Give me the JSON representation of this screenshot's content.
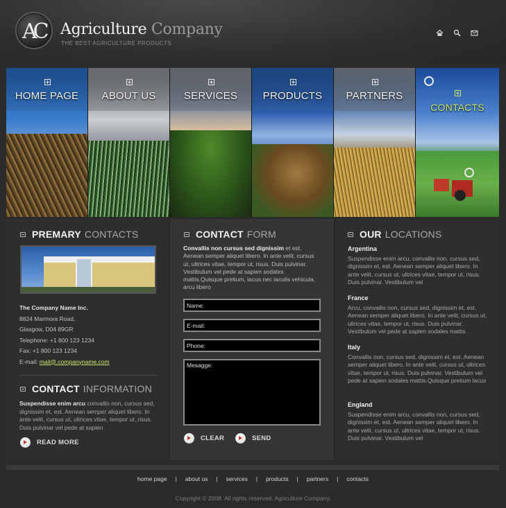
{
  "header": {
    "logo_letters": "AC",
    "brand_bold": "Agriculture",
    "brand_light": "Company",
    "tagline": "THE BEST AGRICULTURE PRODUCTS",
    "icons": [
      "home-icon",
      "search-icon",
      "mail-icon"
    ]
  },
  "nav": {
    "items": [
      {
        "label": "HOME PAGE"
      },
      {
        "label": "ABOUT US"
      },
      {
        "label": "SERVICES"
      },
      {
        "label": "PRODUCTS"
      },
      {
        "label": "PARTNERS"
      },
      {
        "label": "CONTACTS"
      }
    ],
    "active_color": "#c9e86a"
  },
  "primary_contacts": {
    "title_bold": "PREMARY",
    "title_light": "CONTACTS",
    "company": "The Company Name Inc.",
    "street": "8824 Marmora Road,",
    "city": "Glasgow, D04 89GR",
    "telephone": "Telephone: +1 800 123 1234",
    "fax": "Fax: +1 800 123 1234",
    "email_label": "E-mail:",
    "email": "mail@.companyname.com"
  },
  "contact_info": {
    "title_bold": "CONTACT",
    "title_light": "INFORMATION",
    "lead": "Suspendisse enim arcu",
    "text": " convallis non, cursus sed, dignissim et, est. Aenean semper aliquet libero. In ante velit, cursus ut, ultrices vitae, tempor ut, risus. Duis pulvinar vel pede at sapien",
    "read_more": "READ MORE"
  },
  "contact_form": {
    "title_bold": "CONTACT",
    "title_light": "FORM",
    "intro_bold": "Convallis non cursus sed dignissim",
    "intro_text": " et est. Aenean semper aliquet libero. In ante velit, cursus ut, ultrices vitae, tempor ut, risus. Duis pulvinar. Vestibulum vel pede at sapien sodales mattis.Quisque pretium, lacus nec iaculis vehicula, arcu libero",
    "name_value": "Name:",
    "email_value": "E-mail:",
    "phone_value": "Phone:",
    "message_value": "Mesagge:",
    "clear_label": "CLEAR",
    "send_label": "SEND"
  },
  "locations": {
    "title_bold": "OUR",
    "title_light": "LOCATIONS",
    "items": [
      {
        "name": "Argentina",
        "text": "Suspendisse enim arcu, convallis non, cursus sed, dignissim et, est. Aenean semper aliquet libero. In ante velit, cursus ut, ultrices vitae, tempor ut, risus. Duis pulvinar. Vestibulum vel"
      },
      {
        "name": "France",
        "text": "Arcu, convallis non, cursus sed, dignissim et, est. Aenean semper aliquet libero. In ante velit, cursus ut, ultrices vitae, tempor ut, risus. Duis pulvinar. Vestibulum vel pede at sapien sodales mattis."
      },
      {
        "name": "Italy",
        "text": "Convallis non, cursus sed, dignissim et, est. Aenean semper aliquet libero. In ante velit, cursus ut, ultrices vitae, tempor ut, risus. Duis pulvinar. Vestibulum vel pede at sapien sodales mattis.Quisque pretium lacus"
      },
      {
        "name": "England",
        "text": "Suspendisse enim arcu, convallis non, cursus sed, dignissim et, est. Aenean semper aliquet libero. In ante velit, cursus ut, ultrices vitae, tempor ut, risus. Duis pulvinar. Vestibulum vel"
      }
    ]
  },
  "footer": {
    "links": [
      "home page",
      "about us",
      "services",
      "products",
      "partners",
      "contacts"
    ],
    "separator": "|",
    "copyright": "Copyright © 2008. All rights reserved. Agriculture Company."
  }
}
